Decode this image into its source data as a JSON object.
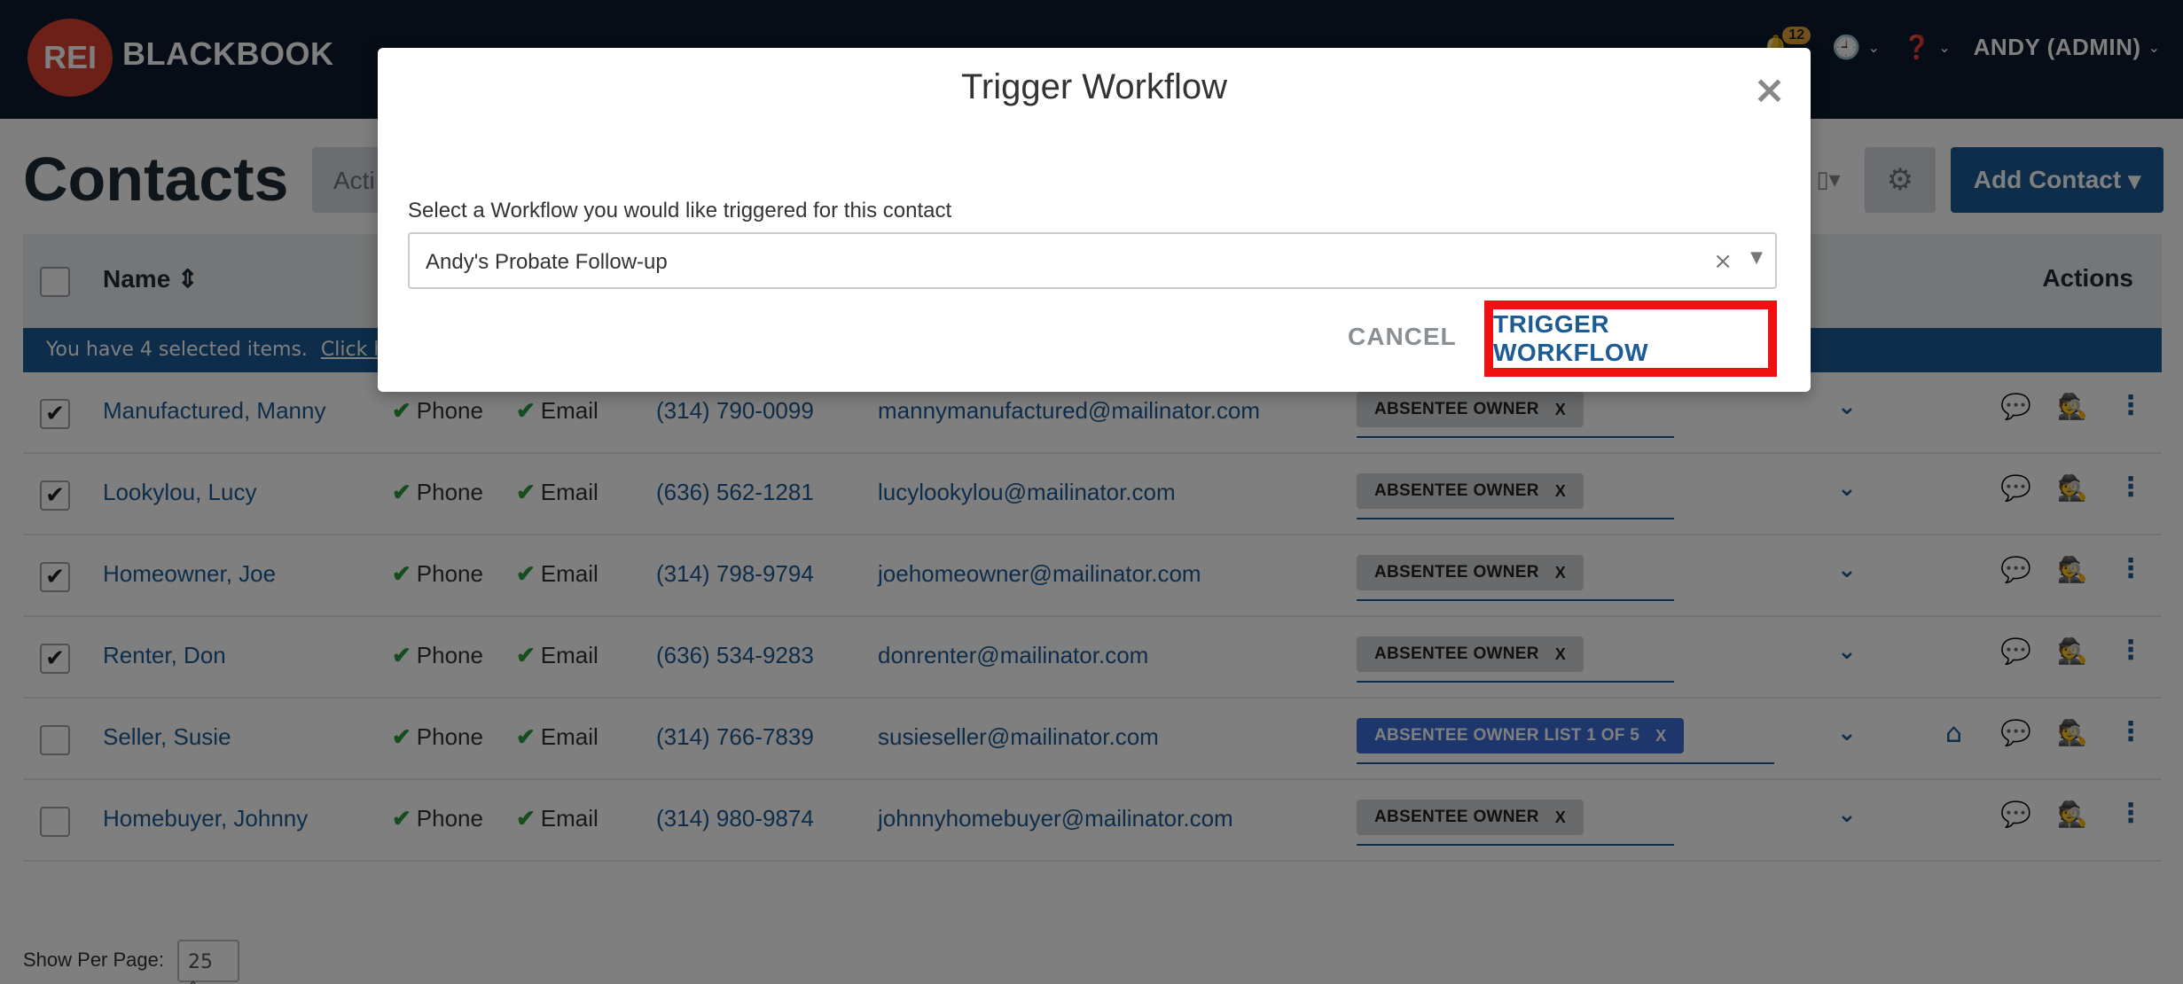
{
  "nav": {
    "logo_mark": "REI",
    "logo_text": "BLACKBOOK",
    "notification_count": "12",
    "user_label": "ANDY (ADMIN)"
  },
  "page": {
    "title": "Contacts",
    "actions_label": "Acti",
    "add_contact_label": "Add Contact"
  },
  "table": {
    "headers": {
      "name": "Name",
      "actions": "Actions"
    },
    "selection_text": "You have 4 selected items.",
    "selection_link": "Click here",
    "phone_flag": "Phone",
    "email_flag": "Email",
    "rows": [
      {
        "checked": true,
        "name": "Manufactured, Manny",
        "phone": "(314) 790-0099",
        "email": "mannymanufactured@mailinator.com",
        "tag": "ABSENTEE OWNER",
        "tag_style": "gray",
        "home": false
      },
      {
        "checked": true,
        "name": "Lookylou, Lucy",
        "phone": "(636) 562-1281",
        "email": "lucylookylou@mailinator.com",
        "tag": "ABSENTEE OWNER",
        "tag_style": "gray",
        "home": false
      },
      {
        "checked": true,
        "name": "Homeowner, Joe",
        "phone": "(314) 798-9794",
        "email": "joehomeowner@mailinator.com",
        "tag": "ABSENTEE OWNER",
        "tag_style": "gray",
        "home": false
      },
      {
        "checked": true,
        "name": "Renter, Don",
        "phone": "(636) 534-9283",
        "email": "donrenter@mailinator.com",
        "tag": "ABSENTEE OWNER",
        "tag_style": "gray",
        "home": false
      },
      {
        "checked": false,
        "name": "Seller, Susie",
        "phone": "(314) 766-7839",
        "email": "susieseller@mailinator.com",
        "tag": "ABSENTEE OWNER LIST 1 OF 5",
        "tag_style": "blue",
        "home": true
      },
      {
        "checked": false,
        "name": "Homebuyer, Johnny",
        "phone": "(314) 980-9874",
        "email": "johnnyhomebuyer@mailinator.com",
        "tag": "ABSENTEE OWNER",
        "tag_style": "gray",
        "home": false
      }
    ],
    "tag_remove": "X"
  },
  "pagination": {
    "per_page_label": "Show Per Page:",
    "per_page_value": "25"
  },
  "modal": {
    "title": "Trigger Workflow",
    "close": "×",
    "select_label": "Select a Workflow you would like triggered for this contact",
    "selected_value": "Andy's Probate Follow-up",
    "clear": "×",
    "cancel_label": "CANCEL",
    "trigger_label": "TRIGGER WORKFLOW"
  },
  "colors": {
    "nav_bg": "#0f1b2d",
    "brand_blue": "#1c5b94",
    "logo_red": "#d8402e",
    "highlight_red": "#ee1111",
    "check_green": "#2b9a3b"
  }
}
